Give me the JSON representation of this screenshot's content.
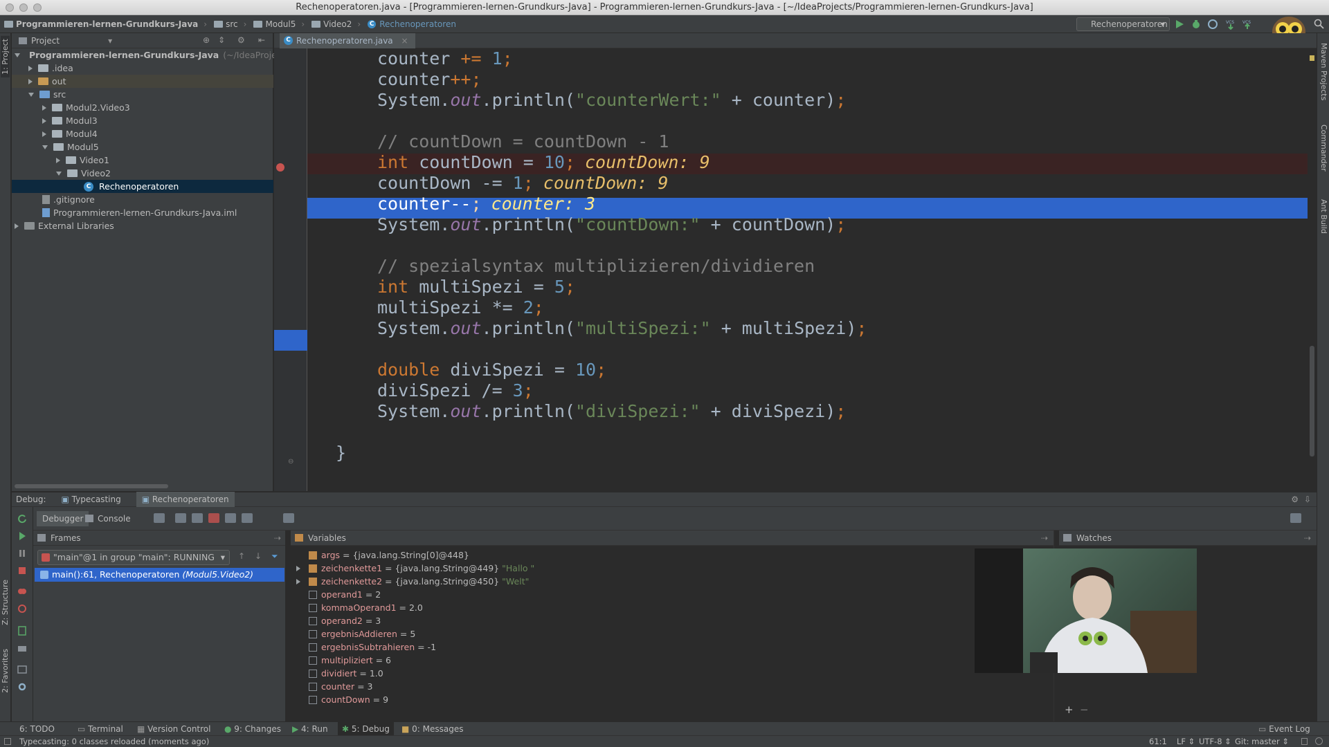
{
  "window": {
    "title": "Rechenoperatoren.java - [Programmieren-lernen-Grundkurs-Java] - Programmieren-lernen-Grundkurs-Java - [~/IdeaProjects/Programmieren-lernen-Grundkurs-Java]"
  },
  "navbar": {
    "crumbs": [
      "Programmieren-lernen-Grundkurs-Java",
      "src",
      "Modul5",
      "Video2",
      "Rechenoperatoren"
    ],
    "run_config": "Rechenoperatoren"
  },
  "left_stripe": {
    "project": "1: Project",
    "structure": "Z: Structure",
    "favorites": "2: Favorites"
  },
  "right_stripe": {
    "maven": "Maven Projects",
    "commander": "Commander",
    "ant": "Ant Build"
  },
  "project_panel": {
    "header": "Project",
    "tree": {
      "root": "Programmieren-lernen-Grundkurs-Java",
      "root_path": "(~/IdeaProject",
      "idea": ".idea",
      "out": "out",
      "src": "src",
      "m2v3": "Modul2.Video3",
      "m3": "Modul3",
      "m4": "Modul4",
      "m5": "Modul5",
      "v1": "Video1",
      "v2": "Video2",
      "rech": "Rechenoperatoren",
      "gitignore": ".gitignore",
      "iml": "Programmieren-lernen-Grundkurs-Java.iml",
      "extlib": "External Libraries"
    }
  },
  "editor": {
    "tab": "Rechenoperatoren.java",
    "inline_values": {
      "countdown1": "countDown: 9",
      "countdown2": "countDown: 9",
      "counter": "counter: 3"
    }
  },
  "debug": {
    "label": "Debug:",
    "tabs": [
      "Typecasting",
      "Rechenoperatoren"
    ],
    "subtabs": {
      "debugger": "Debugger",
      "console": "Console"
    },
    "frames": {
      "header": "Frames",
      "thread": "\"main\"@1 in group \"main\": RUNNING",
      "frame": "main():61, Rechenoperatoren",
      "frame_pkg": "(Modul5.Video2)"
    },
    "variables": {
      "header": "Variables",
      "rows": [
        {
          "name": "args",
          "value": " = {java.lang.String[0]@448}",
          "str": "",
          "expandable": false,
          "obj": true
        },
        {
          "name": "zeichenkette1",
          "value": " = {java.lang.String@449} ",
          "str": "\"Hallo \"",
          "expandable": true,
          "obj": true
        },
        {
          "name": "zeichenkette2",
          "value": " = {java.lang.String@450} ",
          "str": "\"Welt\"",
          "expandable": true,
          "obj": true
        },
        {
          "name": "operand1",
          "value": " = 2",
          "str": "",
          "expandable": false,
          "obj": false
        },
        {
          "name": "kommaOperand1",
          "value": " = 2.0",
          "str": "",
          "expandable": false,
          "obj": false
        },
        {
          "name": "operand2",
          "value": " = 3",
          "str": "",
          "expandable": false,
          "obj": false
        },
        {
          "name": "ergebnisAddieren",
          "value": " = 5",
          "str": "",
          "expandable": false,
          "obj": false
        },
        {
          "name": "ergebnisSubtrahieren",
          "value": " = -1",
          "str": "",
          "expandable": false,
          "obj": false
        },
        {
          "name": "multipliziert",
          "value": " = 6",
          "str": "",
          "expandable": false,
          "obj": false
        },
        {
          "name": "dividiert",
          "value": " = 1.0",
          "str": "",
          "expandable": false,
          "obj": false
        },
        {
          "name": "counter",
          "value": " = 3",
          "str": "",
          "expandable": false,
          "obj": false
        },
        {
          "name": "countDown",
          "value": " = 9",
          "str": "",
          "expandable": false,
          "obj": false
        }
      ]
    },
    "watches": {
      "header": "Watches",
      "add": "+",
      "remove": "−"
    }
  },
  "toolstrip": {
    "todo": "6: TODO",
    "terminal": "Terminal",
    "vcs": "Version Control",
    "changes": "9: Changes",
    "run": "4: Run",
    "debug": "5: Debug",
    "messages": "0: Messages",
    "eventlog": "Event Log"
  },
  "status": {
    "message": "Typecasting: 0 classes reloaded (moments ago)",
    "position": "61:1",
    "line_sep": "LF",
    "encoding": "UTF-8",
    "git": "Git: master"
  },
  "colors": {
    "selection": "#2f65ca",
    "breakpoint": "#c75450",
    "background": "#2b2b2b",
    "panel": "#3c3f41"
  }
}
